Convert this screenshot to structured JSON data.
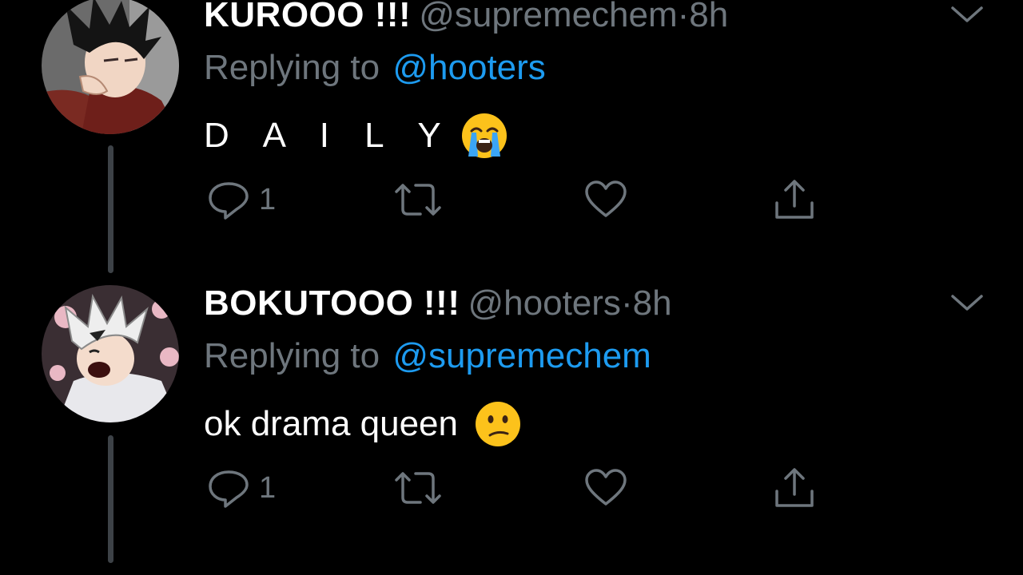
{
  "tweets": [
    {
      "display_name": "KUROOO !!!",
      "handle": "@supremechem",
      "separator": "·",
      "time": "8h",
      "replying_label": "Replying to",
      "replying_to": "@hooters",
      "text": "D A I L Y",
      "emoji": "loudly-crying-face",
      "reply_count": "1",
      "avatar": "kuroo-anime-avatar"
    },
    {
      "display_name": "BOKUTOOO !!!",
      "handle": "@hooters",
      "separator": "·",
      "time": "8h",
      "replying_label": "Replying to",
      "replying_to": "@supremechem",
      "text": "ok drama queen",
      "emoji": "confused-face",
      "reply_count": "1",
      "avatar": "bokuto-anime-avatar"
    }
  ],
  "icons": {
    "reply": "reply-icon",
    "retweet": "retweet-icon",
    "like": "heart-icon",
    "share": "share-icon",
    "more": "chevron-down-icon"
  },
  "colors": {
    "background": "#000000",
    "text_primary": "#ffffff",
    "text_secondary": "#6e767d",
    "accent": "#1d9bf0",
    "thread_line": "#3d4247"
  }
}
